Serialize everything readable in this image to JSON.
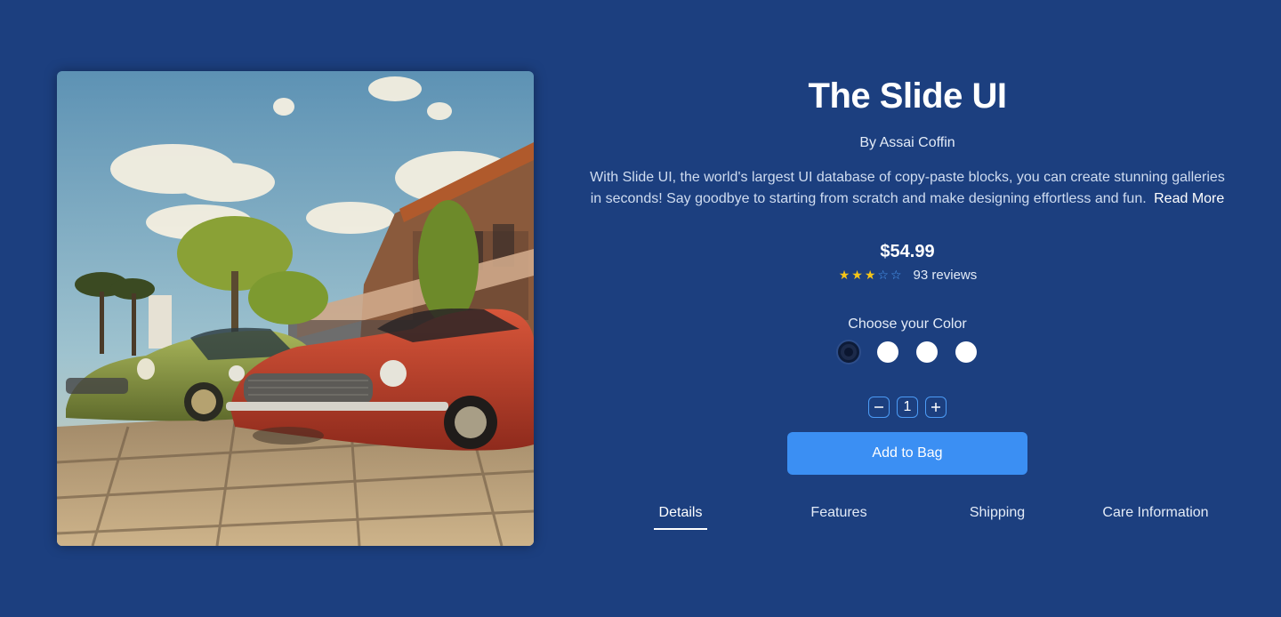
{
  "product": {
    "title": "The Slide UI",
    "author_prefix": "By",
    "author_name": "Assai Coffin",
    "description": "With Slide UI, the world's largest UI database of copy-paste blocks, you can create stunning galleries in seconds! Say goodbye to starting from scratch and make designing effortless and fun.",
    "read_more": "Read More",
    "price": "$54.99",
    "rating": {
      "stars": 3,
      "max": 5,
      "reviews": "93 reviews"
    },
    "color_label": "Choose your Color",
    "colors": [
      "#1c2a4a",
      "#ffffff",
      "#ffffff",
      "#ffffff"
    ],
    "quantity": "1",
    "add_to_bag": "Add to Bag"
  },
  "tabs": [
    "Details",
    "Features",
    "Shipping",
    "Care Information"
  ],
  "active_tab": 0,
  "icons": {
    "minus": "minus-icon",
    "plus": "plus-icon",
    "star": "star-icon"
  },
  "accent": "#3b8ff3"
}
